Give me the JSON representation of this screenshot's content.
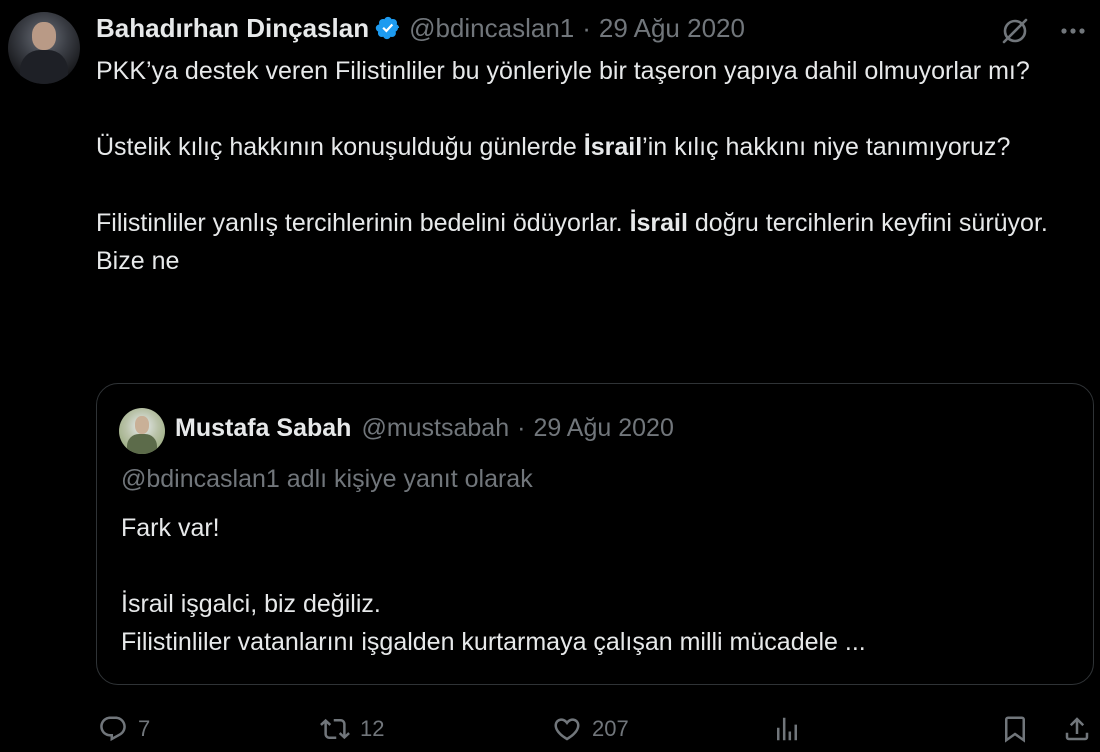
{
  "author": {
    "name": "Bahadırhan Dinçaslan",
    "handle": "@bdincaslan1",
    "separator": "·",
    "date": "29 Ağu 2020"
  },
  "tweet": {
    "p1": "PKK’ya destek veren Filistinliler bu yönleriyle bir taşeron yapıya dahil olmuyorlar mı?",
    "p2_before": "Üstelik kılıç hakkının konuşulduğu günlerde ",
    "p2_bold": "İsrail",
    "p2_after": "’in kılıç hakkını niye tanımıyoruz?",
    "p3_before": "Filistinliler yanlış tercihlerinin bedelini ödüyorlar. ",
    "p3_bold": "İsrail",
    "p3_after": " doğru tercihlerin keyfini sürüyor. Bize ne"
  },
  "quote": {
    "name": "Mustafa Sabah",
    "handle": "@mustsabah",
    "separator": "·",
    "date": "29 Ağu 2020",
    "reply_context": "@bdincaslan1 adlı kişiye yanıt olarak",
    "line1": "Fark var!",
    "line2": "İsrail işgalci, biz değiliz.",
    "line3": "Filistinliler vatanlarını işgalden kurtarmaya çalışan milli mücadele ..."
  },
  "actions": {
    "replies": "7",
    "retweets": "12",
    "likes": "207"
  },
  "icons": {
    "verified": "verified-badge-icon",
    "top_right": [
      "grok-slash-circle-icon",
      "more-icon"
    ],
    "actions": [
      "reply-icon",
      "retweet-icon",
      "like-icon",
      "views-icon",
      "bookmark-icon",
      "share-icon"
    ]
  },
  "colors": {
    "background": "#000000",
    "text": "#e7e9ea",
    "muted": "#71767b",
    "verified": "#1d9bf0",
    "border": "#2f3336"
  }
}
